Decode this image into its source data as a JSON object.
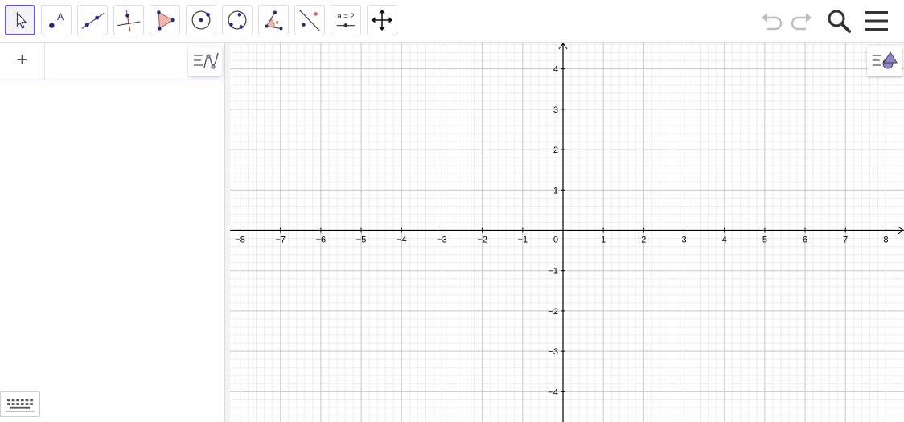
{
  "toolbar": {
    "tools": [
      {
        "id": "move",
        "icon": "move-pointer-icon",
        "selected": true
      },
      {
        "id": "point",
        "icon": "point-icon",
        "label": "A"
      },
      {
        "id": "line",
        "icon": "line-through-two-points-icon"
      },
      {
        "id": "perpendicular",
        "icon": "perpendicular-line-icon"
      },
      {
        "id": "polygon",
        "icon": "polygon-icon"
      },
      {
        "id": "circle",
        "icon": "circle-center-point-icon"
      },
      {
        "id": "circle3",
        "icon": "circle-three-points-icon"
      },
      {
        "id": "angle",
        "icon": "angle-icon",
        "label": "α"
      },
      {
        "id": "reflect",
        "icon": "reflect-about-line-icon"
      },
      {
        "id": "slider",
        "icon": "slider-icon",
        "label": "a = 2"
      },
      {
        "id": "move-view",
        "icon": "move-graphics-view-icon"
      }
    ],
    "right": [
      "undo-icon",
      "redo-icon",
      "search-icon",
      "hamburger-menu-icon"
    ]
  },
  "algebra": {
    "add_label": "+",
    "input_value": "",
    "menu_icon": "algebra-view-menu-icon"
  },
  "graphics": {
    "x_ticks": [
      "−8",
      "−7",
      "−6",
      "−5",
      "−4",
      "−3",
      "−2",
      "−1",
      "0",
      "1",
      "2",
      "3",
      "4",
      "5",
      "6",
      "7",
      "8"
    ],
    "y_ticks_pos": [
      "1",
      "2",
      "3",
      "4"
    ],
    "y_ticks_neg": [
      "−1",
      "−2",
      "−3",
      "−4"
    ],
    "x_range": [
      -8.25,
      8.45
    ],
    "y_range": [
      -4.75,
      4.65
    ],
    "major_step": 1,
    "minor_step": 0.2,
    "grid": true,
    "style_button_icon": "graphics-style-bar-icon"
  },
  "keyboard": {
    "icon": "virtual-keyboard-icon"
  },
  "colors": {
    "accent": "#6557d2",
    "point": "#1e2a8c",
    "grid_major": "#c8c8c8",
    "grid_minor": "#ececec"
  }
}
